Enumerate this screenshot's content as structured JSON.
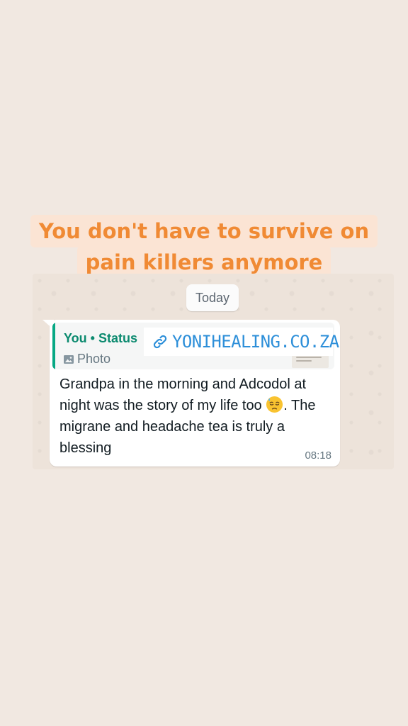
{
  "headline": {
    "line1": "You don't have to survive on",
    "line2": "pain killers anymore"
  },
  "chat": {
    "date_chip": "Today",
    "message": {
      "quote": {
        "author": "You • Status",
        "type_label": "Photo",
        "type_icon": "photo-icon",
        "accent_color": "#06a884"
      },
      "text_before_emoji": "Grandpa in the morning and Adcodol at night was the story of my life too ",
      "emoji": "downcast-face-with-sweat-emoji",
      "text_after_emoji": ". The migrane and headache tea is truly a blessing",
      "time": "08:18"
    }
  },
  "link_sticker": {
    "icon": "link-icon",
    "text": "YONIHEALING.CO.ZA",
    "color": "#2d8fd9"
  },
  "colors": {
    "background": "#f1e8e1",
    "headline_text": "#f08a34",
    "headline_highlight": "#fbe4d4"
  }
}
